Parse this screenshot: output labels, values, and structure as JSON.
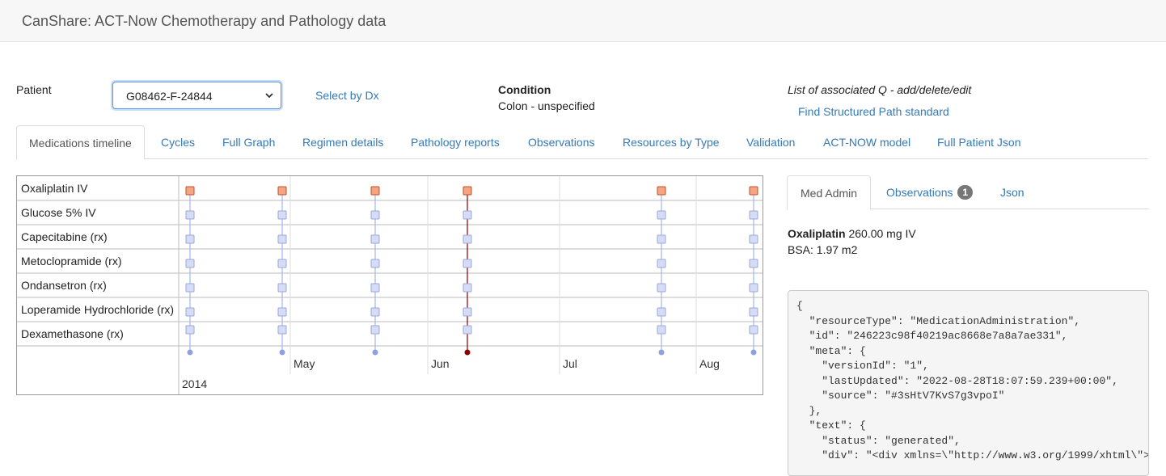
{
  "header": {
    "title": "CanShare: ACT-Now Chemotherapy and Pathology data"
  },
  "patient": {
    "label": "Patient",
    "selected": "G08462-F-24844",
    "select_by_dx": "Select by Dx"
  },
  "condition": {
    "label": "Condition",
    "value": "Colon - unspecified"
  },
  "assoc": {
    "text": "List of associated Q - add/delete/edit",
    "find_link": "Find Structured Path standard"
  },
  "tabs": [
    "Medications timeline",
    "Cycles",
    "Full Graph",
    "Regimen details",
    "Pathology reports",
    "Observations",
    "Resources by Type",
    "Validation",
    "ACT-NOW model",
    "Full Patient Json"
  ],
  "timeline": {
    "rows": [
      "Oxaliplatin IV",
      "Glucose 5% IV",
      "Capecitabine (rx)",
      "Metoclopramide (rx)",
      "Ondansetron (rx)",
      "Loperamide Hydrochloride (rx)",
      "Dexamethasone (rx)"
    ],
    "months": [
      "May",
      "Jun",
      "Jul",
      "Aug"
    ],
    "year": "2014",
    "cycle_count": 6,
    "selected_cycle": 4,
    "colors": {
      "oxaliplatin": "#f4a582",
      "other": "#d6dcf5",
      "selected_line": "#8b0000",
      "line": "#a4b4e8"
    }
  },
  "right": {
    "tabs": {
      "med_admin": "Med Admin",
      "observations": "Observations",
      "observations_badge": "1",
      "json": "Json"
    },
    "drug": "Oxaliplatin",
    "dose": "260.00 mg IV",
    "bsa": "BSA: 1.97 m2",
    "json_lines": [
      "{",
      "  \"resourceType\": \"MedicationAdministration\",",
      "  \"id\": \"246223c98f40219ac8668e7a8a7ae331\",",
      "  \"meta\": {",
      "    \"versionId\": \"1\",",
      "    \"lastUpdated\": \"2022-08-28T18:07:59.239+00:00\",",
      "    \"source\": \"#3sHtV7KvS7g3vpoI\"",
      "  },",
      "  \"text\": {",
      "    \"status\": \"generated\",",
      "    \"div\": \"<div xmlns=\\\"http://www.w3.org/1999/xhtml\\\">"
    ]
  }
}
